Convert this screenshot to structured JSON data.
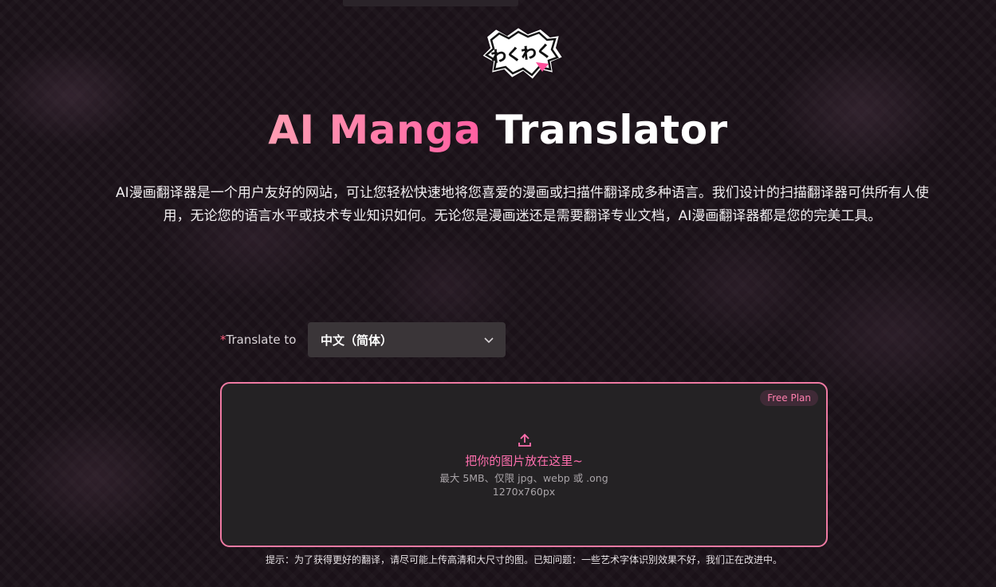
{
  "logo": {
    "text": "わくわく",
    "icon": "burst-logo-icon"
  },
  "header": {
    "title_accent": "AI Manga",
    "title_rest": "Translator",
    "description": "AI漫画翻译器是一个用户友好的网站，可让您轻松快速地将您喜爱的漫画或扫描件翻译成多种语言。我们设计的扫描翻译器可供所有人使用，无论您的语言水平或技术专业知识如何。无论您是漫画迷还是需要翻译专业文档，AI漫画翻译器都是您的完美工具。"
  },
  "translate": {
    "required_mark": "*",
    "label": "Translate to",
    "selected": "中文（简体）",
    "icon": "chevron-down-icon"
  },
  "dropzone": {
    "plan_badge": "Free Plan",
    "icon": "upload-icon",
    "main_text": "把你的图片放在这里~",
    "limits_text": "最大 5MB、仅限 jpg、webp 或 .ong",
    "size_text": "1270x760px"
  },
  "tip": "提示：为了获得更好的翻译，请尽可能上传高清和大尺寸的图。已知问题：一些艺术字体识别效果不好，我们正在改进中。",
  "colors": {
    "background": "#1a1118",
    "accent_pink": "#ff5fa2",
    "dropzone_border": "#f07aa3"
  }
}
